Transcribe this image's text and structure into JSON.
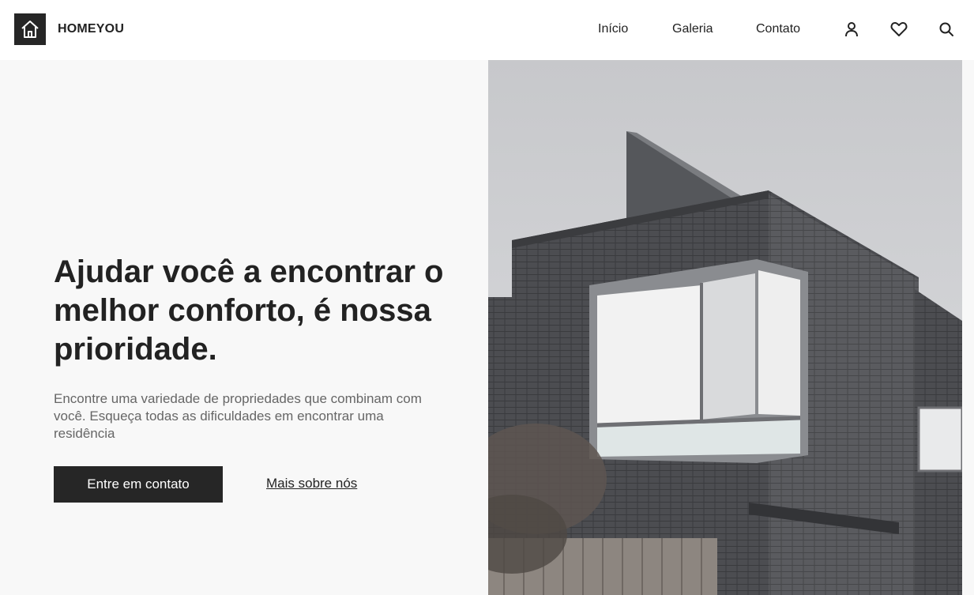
{
  "header": {
    "brand": "HOMEYOU",
    "logo_icon": "house-icon",
    "nav": [
      {
        "label": "Início"
      },
      {
        "label": "Galeria"
      },
      {
        "label": "Contato"
      }
    ],
    "icons": [
      "user-icon",
      "heart-icon",
      "search-icon"
    ]
  },
  "hero": {
    "title": "Ajudar você a encontrar o melhor conforto, é nossa prioridade.",
    "description": "Encontre uma variedade de propriedades que combinam com você. Esqueça todas as dificuldades em encontrar uma residência",
    "primary_button": "Entre em contato",
    "secondary_link": "Mais sobre nós",
    "image_subject": "modern dark brick house"
  },
  "colors": {
    "dark": "#262626",
    "text": "#222222",
    "muted": "#666666",
    "panel_bg": "#f8f8f8"
  }
}
